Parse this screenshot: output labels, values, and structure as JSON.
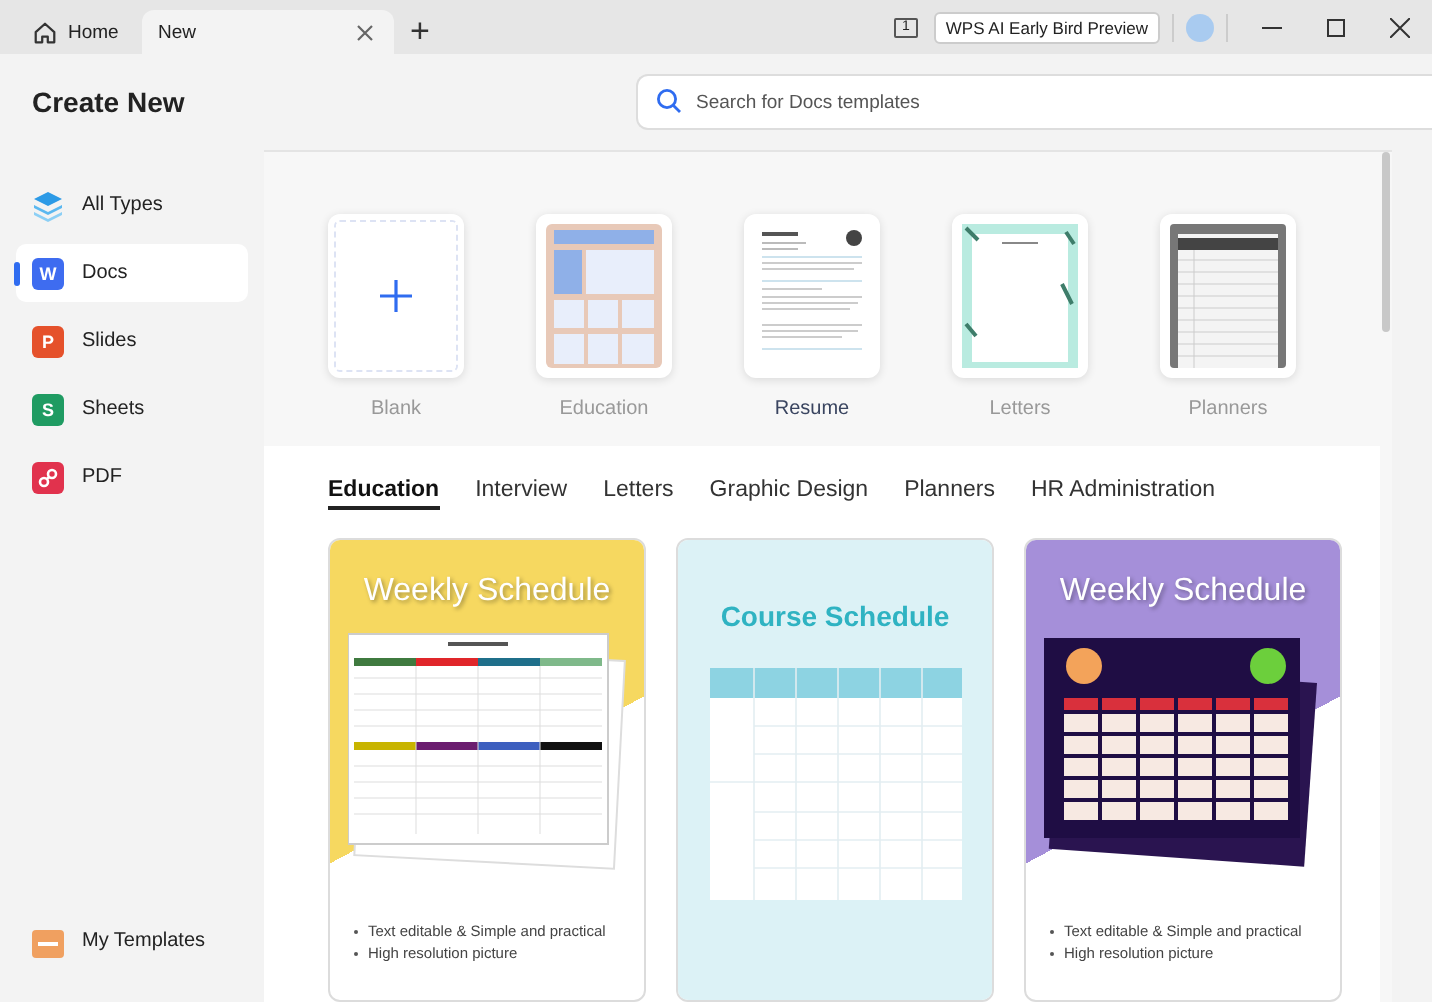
{
  "tabs": [
    {
      "label": "Home",
      "selected": false,
      "closable": false
    },
    {
      "label": "New",
      "selected": true,
      "closable": true
    }
  ],
  "new_tab_symbol": "+",
  "title_bar": {
    "badge": "1",
    "promo_button": "WPS AI Early Bird Preview"
  },
  "header": {
    "title": "Create New"
  },
  "search": {
    "placeholder": "Search for Docs templates"
  },
  "sidebar": {
    "items": [
      {
        "label": "All Types",
        "kind": "layers",
        "selected": false
      },
      {
        "label": "Docs",
        "kind": "letter",
        "letter": "W",
        "color": "#3e6cf0",
        "selected": true
      },
      {
        "label": "Slides",
        "kind": "letter",
        "letter": "P",
        "color": "#e5512b",
        "selected": false
      },
      {
        "label": "Sheets",
        "kind": "letter",
        "letter": "S",
        "color": "#1f9b62",
        "selected": false
      },
      {
        "label": "PDF",
        "kind": "pdf",
        "color": "#e1324d",
        "selected": false
      }
    ],
    "footer": "My Templates"
  },
  "types": [
    {
      "label": "Blank",
      "kind": "blank",
      "selected": false
    },
    {
      "label": "Education",
      "kind": "education",
      "selected": false
    },
    {
      "label": "Resume",
      "kind": "resume",
      "selected": true
    },
    {
      "label": "Letters",
      "kind": "letters",
      "selected": false
    },
    {
      "label": "Planners",
      "kind": "planners",
      "selected": false
    }
  ],
  "categories": [
    {
      "label": "Education",
      "selected": true
    },
    {
      "label": "Interview",
      "selected": false
    },
    {
      "label": "Letters",
      "selected": false
    },
    {
      "label": "Graphic Design",
      "selected": false
    },
    {
      "label": "Planners",
      "selected": false
    },
    {
      "label": "HR Administration",
      "selected": false
    }
  ],
  "templates": [
    {
      "title": "Weekly Schedule",
      "kind": "yellow",
      "bullets": [
        "Text editable & Simple and practical",
        "High resolution picture"
      ]
    },
    {
      "title": "Course Schedule",
      "kind": "teal"
    },
    {
      "title": "Weekly Schedule",
      "kind": "purple",
      "bullets": [
        "Text editable & Simple and practical",
        "High resolution picture"
      ]
    }
  ]
}
